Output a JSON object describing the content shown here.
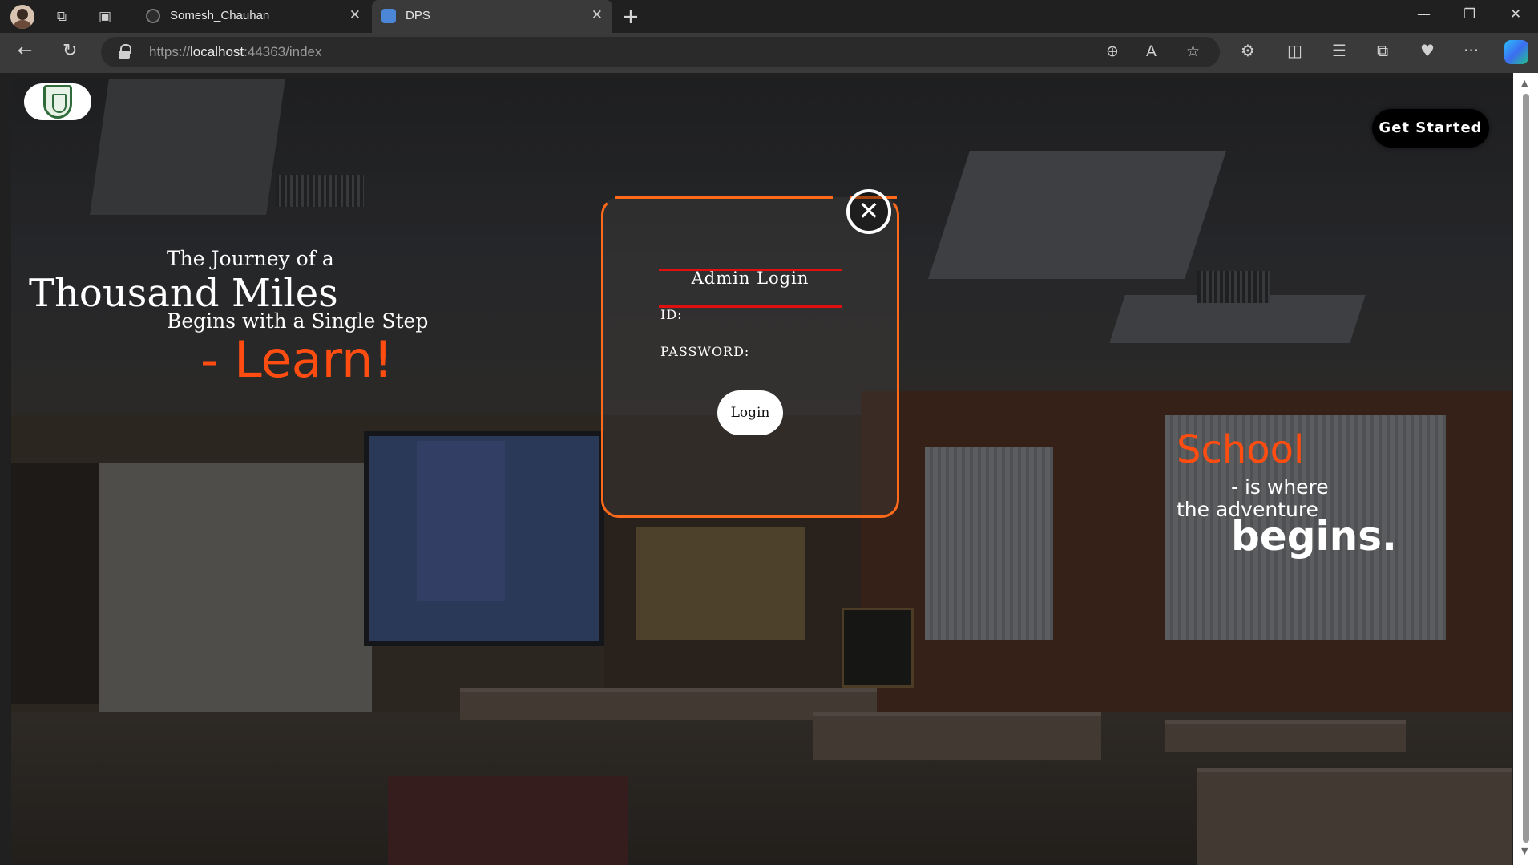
{
  "browser": {
    "tabs": [
      {
        "title": "Somesh_Chauhan",
        "active": false
      },
      {
        "title": "DPS",
        "active": true
      }
    ],
    "url_scheme": "https://",
    "url_host": "localhost",
    "url_rest": ":44363/index"
  },
  "page": {
    "header": {
      "get_started_label": "Get Started"
    },
    "hero_left": {
      "line1": "The Journey of a",
      "line2": "Thousand Miles",
      "line3": "Begins with a Single Step",
      "line4": "- Learn!"
    },
    "hero_right": {
      "line1": "School",
      "line2": "- is where",
      "line3": "the adventure",
      "line4": "begins."
    },
    "login": {
      "title": "Admin Login",
      "id_label": "ID:",
      "id_value": "",
      "password_label": "PASSWORD:",
      "password_value": "",
      "submit_label": "Login",
      "close_symbol": "✕"
    }
  },
  "colors": {
    "accent_orange": "#ff4d12",
    "card_border": "#ff6a1a",
    "input_underline": "#e01010"
  }
}
